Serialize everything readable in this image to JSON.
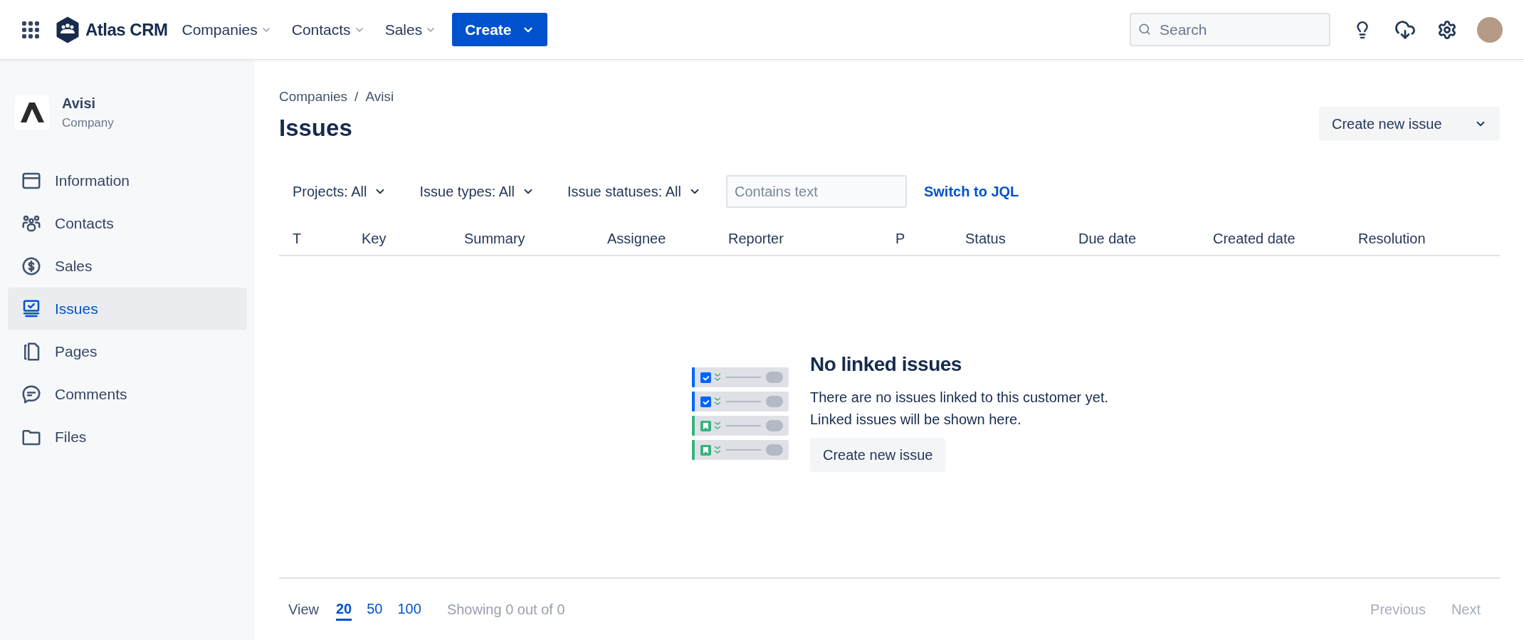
{
  "topbar": {
    "logo": "Atlas CRM",
    "nav": [
      {
        "label": "Companies"
      },
      {
        "label": "Contacts"
      },
      {
        "label": "Sales"
      }
    ],
    "create": "Create",
    "search": {
      "placeholder": "Search"
    }
  },
  "sidebar": {
    "entity": {
      "name": "Avisi",
      "type": "Company"
    },
    "items": [
      {
        "label": "Information",
        "kind": "info",
        "selected": false
      },
      {
        "label": "Contacts",
        "kind": "contacts",
        "selected": false
      },
      {
        "label": "Sales",
        "kind": "sales",
        "selected": false
      },
      {
        "label": "Issues",
        "kind": "issues",
        "selected": true
      },
      {
        "label": "Pages",
        "kind": "pages",
        "selected": false
      },
      {
        "label": "Comments",
        "kind": "comments",
        "selected": false
      },
      {
        "label": "Files",
        "kind": "files",
        "selected": false
      }
    ]
  },
  "breadcrumb": {
    "items": [
      "Companies",
      "Avisi"
    ],
    "separator": "/"
  },
  "title": "Issues",
  "create_button": "Create new issue",
  "filters": [
    {
      "label": "Projects: All"
    },
    {
      "label": "Issue types: All"
    },
    {
      "label": "Issue statuses: All"
    }
  ],
  "text_filter": {
    "placeholder": "Contains text"
  },
  "jql_link": "Switch to JQL",
  "table": {
    "columns": [
      "T",
      "Key",
      "Summary",
      "Assignee",
      "Reporter",
      "P",
      "Status",
      "Due date",
      "Created date",
      "Resolution"
    ]
  },
  "empty_state": {
    "title": "No linked issues",
    "lines": [
      "There are no issues linked to this customer yet.",
      "Linked issues will be shown here."
    ],
    "button": "Create new issue"
  },
  "footer": {
    "view_label": "View",
    "page_sizes": [
      {
        "label": "20",
        "selected": true
      },
      {
        "label": "50",
        "selected": false
      },
      {
        "label": "100",
        "selected": false
      }
    ],
    "summary": "Showing 0 out of 0",
    "previous": {
      "label": "Previous",
      "disabled": true
    },
    "next": {
      "label": "Next",
      "disabled": true
    }
  }
}
